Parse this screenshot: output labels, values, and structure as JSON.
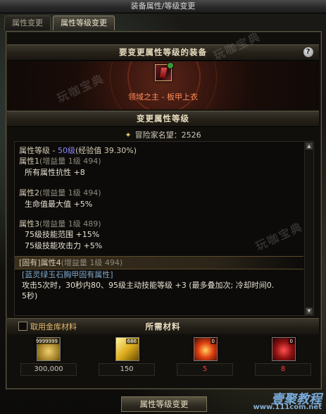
{
  "window": {
    "title": "装备属性/等级变更"
  },
  "tabs": [
    {
      "label": "属性变更",
      "active": false
    },
    {
      "label": "属性等级变更",
      "active": true
    }
  ],
  "equipment_section": {
    "header": "要变更属性等级的装备",
    "help_label": "?",
    "item_name": "领域之主 - 板甲上衣",
    "item_name_color": "#ff8c5a"
  },
  "level_section": {
    "header": "变更属性等级",
    "reputation": "冒险家名望：2526",
    "attribute_level_prefix": "属性等级 - ",
    "attribute_level_value": "50级",
    "attribute_level_suffix": "(经验值 39.30%)",
    "attributes": [
      {
        "name": "属性1",
        "detail": "(增益量 1级 494)",
        "effects": [
          "所有属性抗性 +8"
        ]
      },
      {
        "name": "属性2",
        "detail": "(增益量 1级 494)",
        "effects": [
          "生命值最大值 +5%"
        ]
      },
      {
        "name": "属性3",
        "detail": "(增益量 1级 489)",
        "effects": [
          "75级技能范围 +15%",
          "75级技能攻击力 +5%"
        ]
      },
      {
        "name": "[固有]属性4",
        "detail": "(增益量 1级 494)",
        "effects": []
      }
    ],
    "inherent_title": "[蓝灵绿玉石胸甲固有属性]",
    "inherent_desc_1": "攻击5次时，30秒内80、95级主动技能等级 +3 (最多叠加次; 冷却时间0.",
    "inherent_desc_2": "5秒)"
  },
  "materials_section": {
    "header": "所需材料",
    "use_storage_label": "取用金库材料",
    "items": [
      {
        "icon": "gold-coins-icon",
        "badge": "9999999",
        "count": "300,000",
        "count_color": "#cfc7b8"
      },
      {
        "icon": "yellow-crystal-icon",
        "badge": "686",
        "count": "150",
        "count_color": "#cfc7b8"
      },
      {
        "icon": "fire-orb-icon",
        "badge": "0",
        "count": "5",
        "count_color": "#ff3c3c"
      },
      {
        "icon": "red-spark-icon",
        "badge": "0",
        "count": "8",
        "count_color": "#ff3c3c"
      }
    ]
  },
  "action": {
    "submit_label": "属性等级变更"
  },
  "watermarks": {
    "text": "玩咖宝典",
    "brand": "壹聚教程",
    "brand_url": "www.111com.net"
  }
}
